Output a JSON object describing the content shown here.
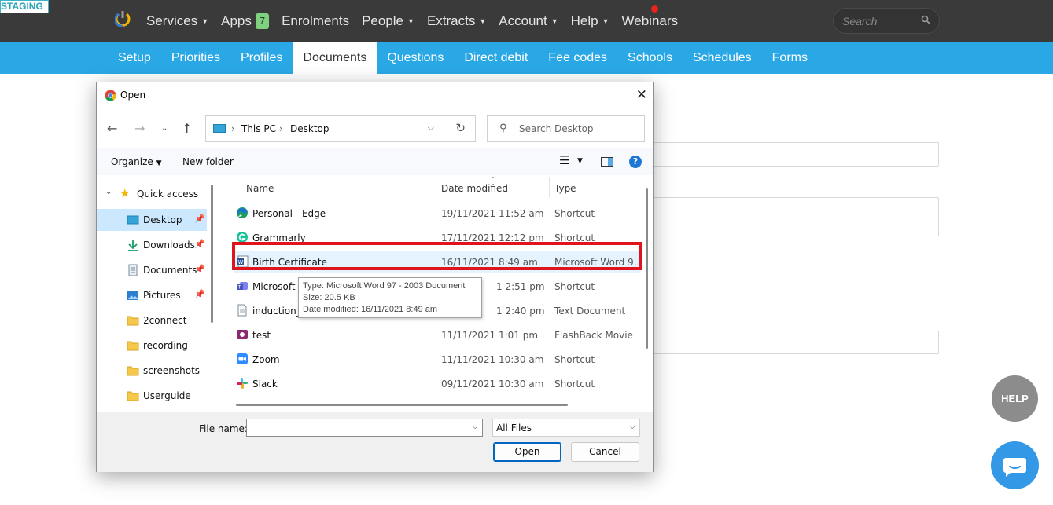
{
  "env_badge": "STAGING",
  "topnav": {
    "items": [
      {
        "label": "Services",
        "caret": true
      },
      {
        "label": "Apps",
        "badge": "7"
      },
      {
        "label": "Enrolments"
      },
      {
        "label": "People",
        "caret": true
      },
      {
        "label": "Extracts",
        "caret": true
      },
      {
        "label": "Account",
        "caret": true
      },
      {
        "label": "Help",
        "caret": true
      },
      {
        "label": "Webinars"
      }
    ],
    "search_placeholder": "Search"
  },
  "subnav": {
    "tabs": [
      "Setup",
      "Priorities",
      "Profiles",
      "Documents",
      "Questions",
      "Direct debit",
      "Fee codes",
      "Schools",
      "Schedules",
      "Forms"
    ],
    "active": "Documents"
  },
  "help_button": "HELP",
  "dialog": {
    "title": "Open",
    "address": {
      "parts": [
        "This PC",
        "Desktop"
      ]
    },
    "search_placeholder": "Search Desktop",
    "toolbar": {
      "organize": "Organize",
      "new_folder": "New folder"
    },
    "nav": [
      {
        "label": "Quick access",
        "icon": "star-icon"
      },
      {
        "label": "Desktop",
        "icon": "desktop-icon",
        "pinned": true,
        "selected": true
      },
      {
        "label": "Downloads",
        "icon": "download-icon",
        "pinned": true
      },
      {
        "label": "Documents",
        "icon": "document-icon",
        "pinned": true
      },
      {
        "label": "Pictures",
        "icon": "pictures-icon",
        "pinned": true
      },
      {
        "label": "2connect",
        "icon": "folder-icon"
      },
      {
        "label": "recording",
        "icon": "folder-icon"
      },
      {
        "label": "screenshots",
        "icon": "folder-icon"
      },
      {
        "label": "Userguide",
        "icon": "folder-icon"
      }
    ],
    "columns": [
      "Name",
      "Date modified",
      "Type"
    ],
    "files": [
      {
        "name": "Personal - Edge",
        "date": "19/11/2021 11:52 am",
        "type": "Shortcut",
        "icon": "edge-icon"
      },
      {
        "name": "Grammarly",
        "date": "17/11/2021 12:12 pm",
        "type": "Shortcut",
        "icon": "grammarly-icon"
      },
      {
        "name": "Birth Certificate",
        "date": "16/11/2021 8:49 am",
        "type": "Microsoft Word 9...",
        "icon": "word-icon",
        "highlighted": true
      },
      {
        "name": "Microsoft T",
        "date": "1 2:51 pm",
        "type": "Shortcut",
        "icon": "teams-icon"
      },
      {
        "name": "induction_",
        "date": "1 2:40 pm",
        "type": "Text Document",
        "icon": "text-file-icon"
      },
      {
        "name": "test",
        "date": "11/11/2021 1:01 pm",
        "type": "FlashBack Movie",
        "icon": "flashback-icon"
      },
      {
        "name": "Zoom",
        "date": "11/11/2021 10:30 am",
        "type": "Shortcut",
        "icon": "zoom-icon"
      },
      {
        "name": "Slack",
        "date": "09/11/2021 10:30 am",
        "type": "Shortcut",
        "icon": "slack-icon"
      }
    ],
    "tooltip": {
      "type": "Type: Microsoft Word 97 - 2003 Document",
      "size": "Size: 20.5 KB",
      "date": "Date modified: 16/11/2021 8:49 am"
    },
    "file_name_label": "File name:",
    "file_name_value": "",
    "filter": "All Files",
    "open_label": "Open",
    "cancel_label": "Cancel"
  }
}
